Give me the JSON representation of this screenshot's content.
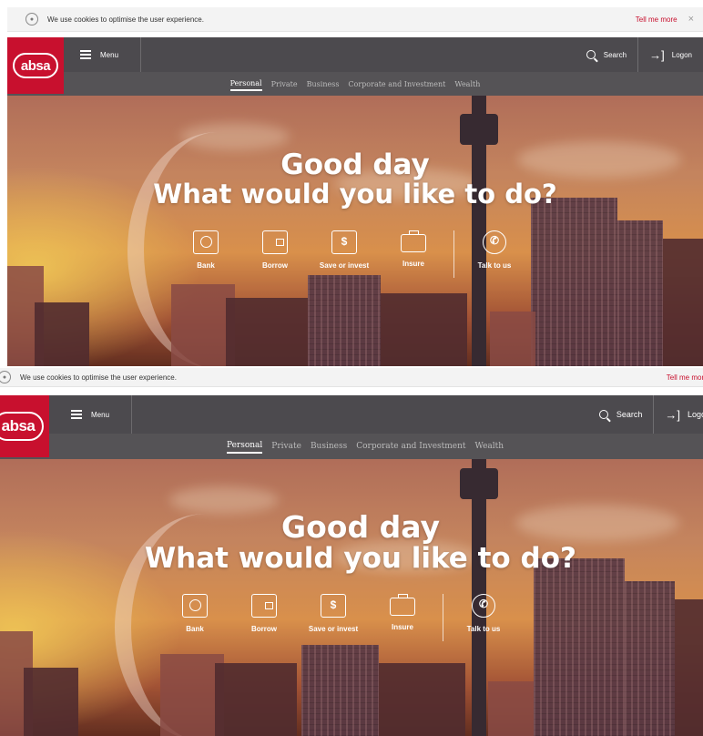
{
  "cookie": {
    "message": "We use cookies to optimise the user experience.",
    "tell_more": "Tell me more",
    "close": "×"
  },
  "logo": {
    "text": "absa"
  },
  "nav": {
    "menu_label": "Menu",
    "search_label": "Search",
    "logon_label": "Logon"
  },
  "tabs": [
    "Personal",
    "Private",
    "Business",
    "Corporate and Investment",
    "Wealth"
  ],
  "active_tab": "Personal",
  "hero": {
    "line1": "Good day",
    "line2": "What would you like to do?",
    "actions": [
      {
        "label": "Bank",
        "icon": "safe-icon"
      },
      {
        "label": "Borrow",
        "icon": "wallet-icon"
      },
      {
        "label": "Save or invest",
        "icon": "piggy-jar-icon"
      },
      {
        "label": "Insure",
        "icon": "briefcase-icon"
      },
      {
        "label": "Talk to us",
        "icon": "chat-phone-icon"
      }
    ]
  },
  "colors": {
    "brand": "#c8102e",
    "nav": "#464448"
  }
}
